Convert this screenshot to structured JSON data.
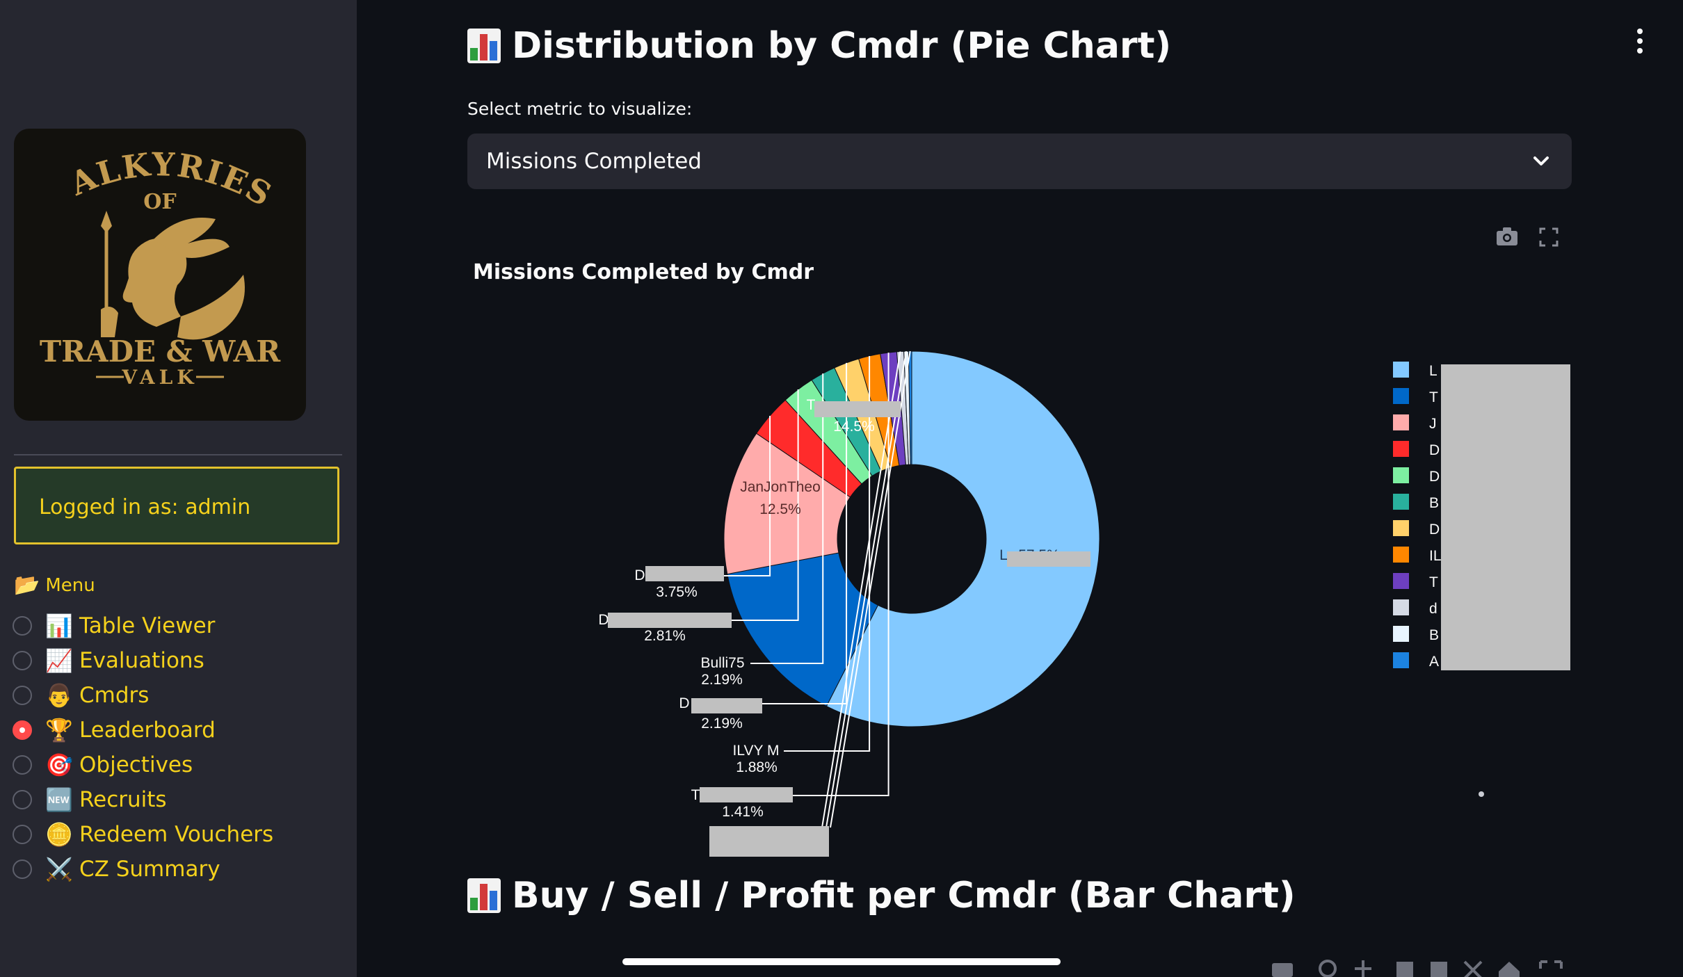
{
  "sidebar": {
    "logo": {
      "line1": "VALKYRIES",
      "line2": "OF",
      "line3": "TRADE & WAR",
      "line4": "VALK"
    },
    "login_text": "Logged in as: admin",
    "menu_title": "Menu",
    "menu_title_icon": "folder-icon",
    "menu": [
      {
        "label": "Table Viewer",
        "icon": "📊",
        "checked": false
      },
      {
        "label": "Evaluations",
        "icon": "📈",
        "checked": false
      },
      {
        "label": "Cmdrs",
        "icon": "👨",
        "checked": false
      },
      {
        "label": "Leaderboard",
        "icon": "🏆",
        "checked": true
      },
      {
        "label": "Objectives",
        "icon": "🎯",
        "checked": false
      },
      {
        "label": "Recruits",
        "icon": "🆕",
        "checked": false
      },
      {
        "label": "Redeem Vouchers",
        "icon": "🪙",
        "checked": false
      },
      {
        "label": "CZ Summary",
        "icon": "⚔️",
        "checked": false
      }
    ]
  },
  "main": {
    "heading1": "Distribution by Cmdr (Pie Chart)",
    "select_label": "Select metric to visualize:",
    "select_value": "Missions Completed",
    "heading2": "Buy / Sell / Profit per Cmdr (Bar Chart)"
  },
  "chart_data": {
    "type": "pie",
    "title": "Missions Completed by Cmdr",
    "hole": true,
    "legend_position": "right",
    "slices": [
      {
        "label": "L",
        "value": 57.5,
        "color": "#83c9ff",
        "shown_pct": "57.5%"
      },
      {
        "label": "T",
        "value": 14.5,
        "color": "#0068c9",
        "shown_pct": "14.5%"
      },
      {
        "label": "JanJonTheo",
        "value": 12.5,
        "color": "#ffabab",
        "shown_pct": "12.5%"
      },
      {
        "label": "D",
        "value": 3.75,
        "color": "#ff2b2b",
        "shown_pct": "3.75%"
      },
      {
        "label": "D",
        "value": 2.81,
        "color": "#7defa1",
        "shown_pct": "2.81%"
      },
      {
        "label": "Bulli75",
        "value": 2.19,
        "color": "#29b09d",
        "shown_pct": "2.19%"
      },
      {
        "label": "D",
        "value": 2.19,
        "color": "#ffd16a",
        "shown_pct": "2.19%"
      },
      {
        "label": "ILVY M",
        "value": 1.88,
        "color": "#ff8700",
        "shown_pct": "1.88%"
      },
      {
        "label": "T",
        "value": 1.41,
        "color": "#6d3fc0",
        "shown_pct": "1.41%"
      },
      {
        "label": "d",
        "value": 0.6,
        "color": "#d5dae5",
        "shown_pct": ""
      },
      {
        "label": "B",
        "value": 0.4,
        "color": "#e8f4ff",
        "shown_pct": ""
      },
      {
        "label": "A",
        "value": 0.27,
        "color": "#1c83e1",
        "shown_pct": ""
      }
    ],
    "legend": [
      "L",
      "T",
      "J",
      "D",
      "D",
      "B",
      "D",
      "IL",
      "T",
      "d",
      "B",
      "A"
    ]
  },
  "colors": {
    "accent_yellow": "#f5d11c",
    "background": "#0e1117",
    "sidebar": "#262730",
    "radio_active": "#ff4b4b"
  }
}
